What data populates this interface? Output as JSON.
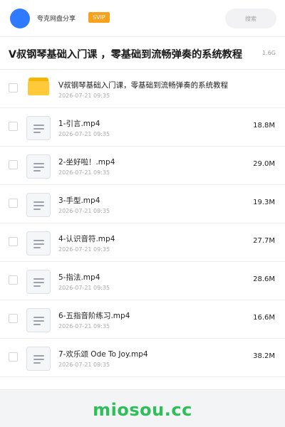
{
  "header": {
    "app_name": "夸克网盘分享",
    "badge": "SVIP",
    "search_placeholder": "搜索"
  },
  "folder": {
    "title": "V叔钢琴基础入门课 ，零基础到流畅弹奏的系统教程",
    "total_size": "1.6G"
  },
  "files": [
    {
      "name": "V叔钢琴基础入门课，零基础到流畅弹奏的系统教程",
      "date": "2026-07-21 09:35",
      "size": "",
      "type": "folder"
    },
    {
      "name": "1-引言.mp4",
      "date": "2026-07-21 09:35",
      "size": "18.8M",
      "type": "file"
    },
    {
      "name": "2-坐好啦！.mp4",
      "date": "2026-07-21 09:35",
      "size": "29.0M",
      "type": "file"
    },
    {
      "name": "3-手型.mp4",
      "date": "2026-07-21 09:35",
      "size": "19.3M",
      "type": "file"
    },
    {
      "name": "4-认识音符.mp4",
      "date": "2026-07-21 09:35",
      "size": "27.7M",
      "type": "file"
    },
    {
      "name": "5-指法.mp4",
      "date": "2026-07-21 09:35",
      "size": "28.6M",
      "type": "file"
    },
    {
      "name": "6-五指音阶练习.mp4",
      "date": "2026-07-21 09:35",
      "size": "16.6M",
      "type": "file"
    },
    {
      "name": "7-欢乐颂 Ode To Joy.mp4",
      "date": "2026-07-21 09:35",
      "size": "38.2M",
      "type": "file"
    }
  ],
  "watermark": "miosou.cc"
}
